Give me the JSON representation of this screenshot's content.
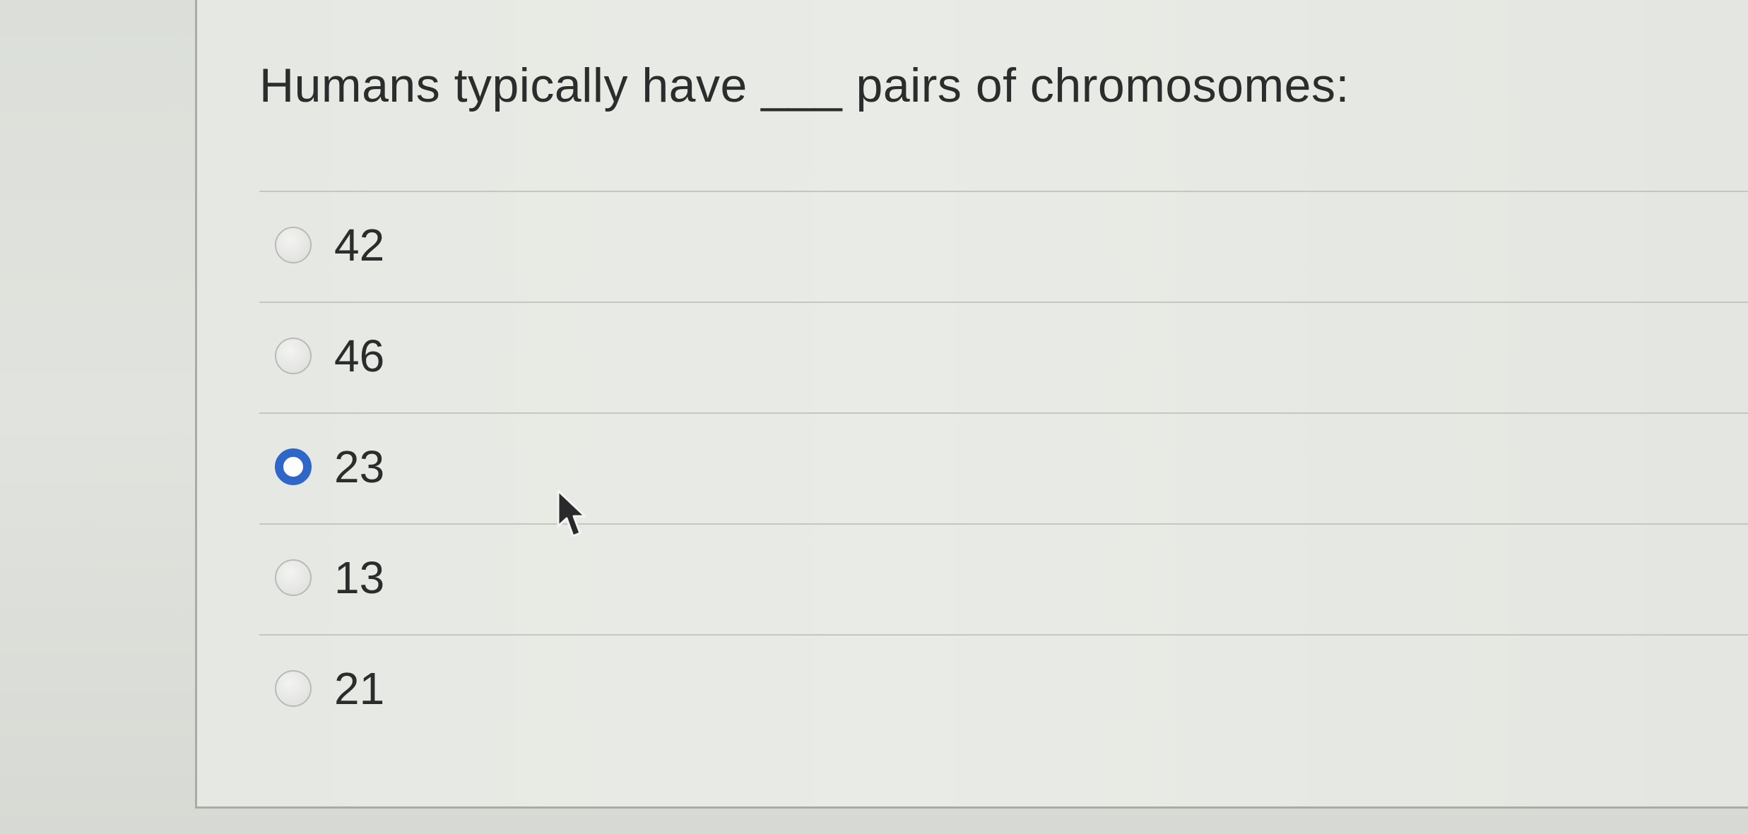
{
  "question": {
    "text": "Humans typically have ___ pairs of chromosomes:"
  },
  "options": [
    {
      "label": "42",
      "selected": false
    },
    {
      "label": "46",
      "selected": false
    },
    {
      "label": "23",
      "selected": true
    },
    {
      "label": "13",
      "selected": false
    },
    {
      "label": "21",
      "selected": false
    }
  ],
  "colors": {
    "selected_radio": "#2f67c8",
    "text": "#2b2c2c",
    "divider": "#c4c7c1"
  },
  "icons": {
    "cursor": "arrow-cursor-icon"
  }
}
